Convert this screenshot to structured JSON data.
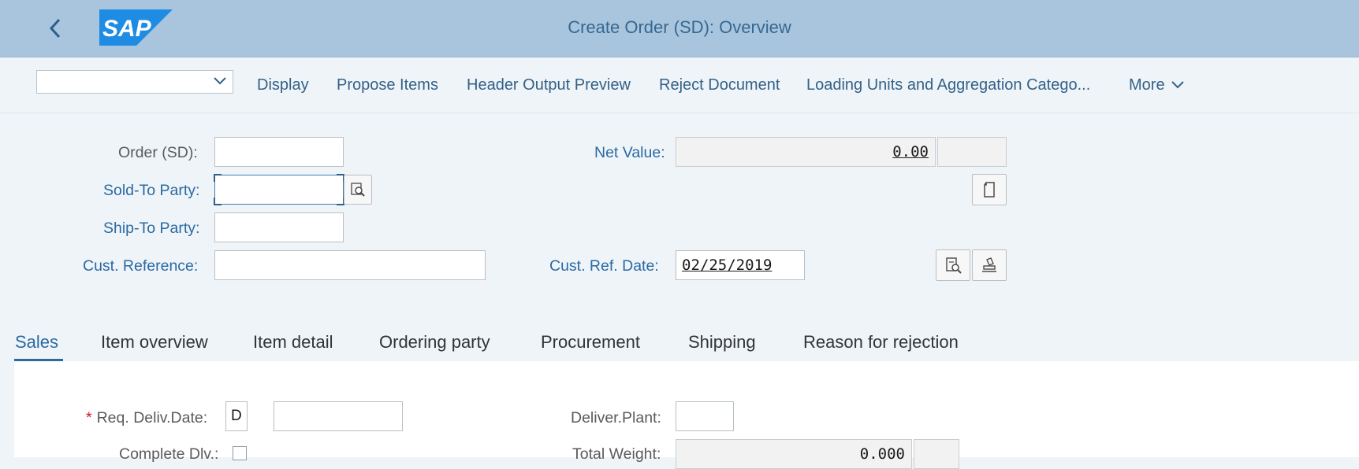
{
  "header": {
    "title": "Create Order (SD): Overview",
    "logo_text": "SAP",
    "back_icon": "chevron-left-icon"
  },
  "toolbar": {
    "dropdown_value": "",
    "buttons": [
      "Display",
      "Propose Items",
      "Header Output Preview",
      "Reject Document",
      "Loading Units and Aggregation Catego...",
      "More"
    ]
  },
  "form": {
    "order_label": "Order (SD):",
    "order_value": "",
    "sold_to_label": "Sold-To Party:",
    "sold_to_value": "",
    "ship_to_label": "Ship-To Party:",
    "ship_to_value": "",
    "cust_ref_label": "Cust. Reference:",
    "cust_ref_value": "",
    "net_value_label": "Net Value:",
    "net_value": "0.00",
    "currency": "",
    "cust_ref_date_label": "Cust. Ref. Date:",
    "cust_ref_date": "02/25/2019"
  },
  "tabs": [
    "Sales",
    "Item overview",
    "Item detail",
    "Ordering party",
    "Procurement",
    "Shipping",
    "Reason for rejection"
  ],
  "sales": {
    "req_deliv_label": "Req. Deliv.Date:",
    "req_deliv_format": "D",
    "req_deliv_value": "",
    "deliver_plant_label": "Deliver.Plant:",
    "deliver_plant_value": "",
    "complete_dly_label": "Complete Dlv.:",
    "total_weight_label": "Total Weight:",
    "total_weight": "0.000",
    "weight_unit": ""
  },
  "colors": {
    "shell": "#a9c5de",
    "accent": "#2a6aa1",
    "logo": "#1e8ce3",
    "background": "#eff4f9"
  }
}
